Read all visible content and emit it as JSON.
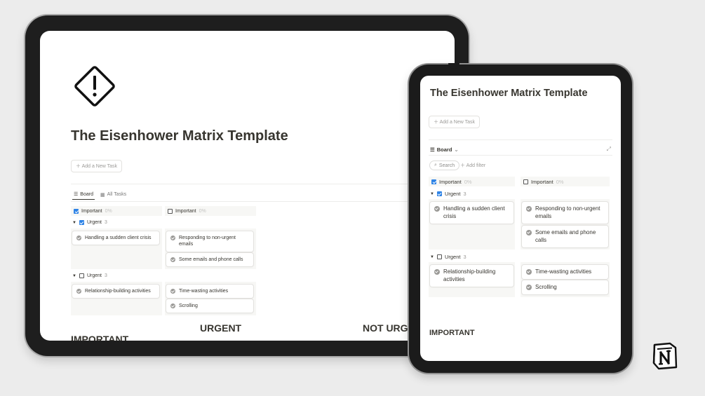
{
  "page": {
    "title": "The Eisenhower Matrix Template",
    "add_task": "Add a New Task",
    "tabs": {
      "board": "Board",
      "all_tasks": "All Tasks"
    },
    "toolbar": {
      "search": "Search",
      "add_filter": "Add filter"
    },
    "columns": [
      {
        "label": "Important",
        "checked": true,
        "count": "0%"
      },
      {
        "label": "Important",
        "checked": false,
        "count": "0%"
      }
    ],
    "groups": [
      {
        "label": "Urgent",
        "checked": true,
        "count": "3"
      },
      {
        "label": "Urgent",
        "checked": false,
        "count": "3"
      }
    ],
    "cards": {
      "urgent_important": [
        "Handling a sudden client crisis"
      ],
      "urgent_not_important": [
        "Responding to non-urgent emails",
        "Some emails and phone calls"
      ],
      "not_urgent_important": [
        "Relationship-building activities"
      ],
      "not_urgent_not_important": [
        "Time-wasting activities",
        "Scrolling"
      ]
    },
    "footer_labels": {
      "important": "IMPORTANT",
      "urgent": "URGENT",
      "not_urgent": "NOT URG"
    }
  },
  "icons": {
    "warning": "warning-diamond-icon",
    "plus": "plus-icon",
    "board": "list-icon",
    "table": "table-icon",
    "search": "search-icon",
    "expand": "expand-icon",
    "brand": "notion-logo-icon"
  },
  "colors": {
    "accent": "#2e83e6",
    "bezel": "#1e1e1e",
    "background": "#ececec",
    "text": "#37352f"
  }
}
